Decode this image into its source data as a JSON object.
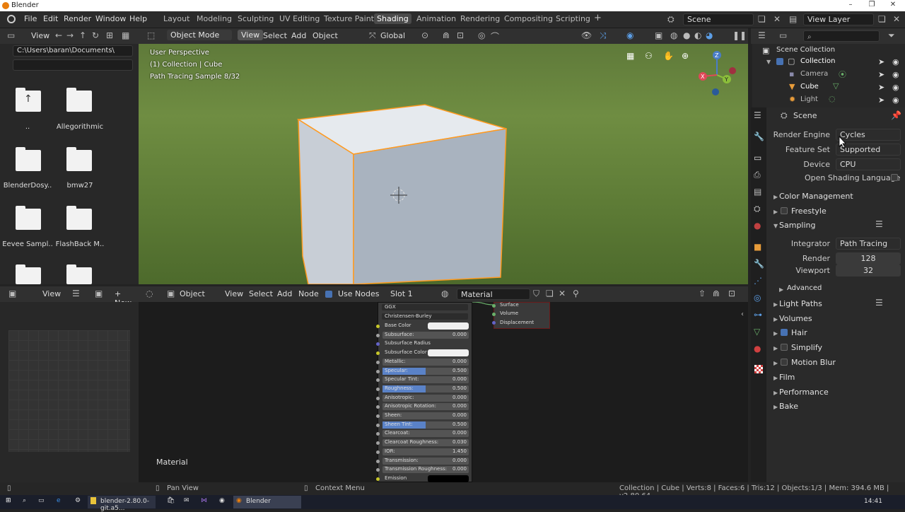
{
  "window": {
    "title": "Blender",
    "min": "–",
    "max": "❐",
    "close": "✕"
  },
  "menus": {
    "file": "File",
    "edit": "Edit",
    "render": "Render",
    "window": "Window",
    "help": "Help"
  },
  "workspaces": [
    "Layout",
    "Modeling",
    "Sculpting",
    "UV Editing",
    "Texture Paint",
    "Shading",
    "Animation",
    "Rendering",
    "Compositing",
    "Scripting"
  ],
  "workspace_add": "+",
  "scene": {
    "name": "Scene",
    "view_layer": "View Layer"
  },
  "filebrowser": {
    "view_label": "View",
    "path": "C:\\Users\\baran\\Documents\\",
    "filter": "",
    "items": [
      {
        "label": ".."
      },
      {
        "label": "Allegorithmic"
      },
      {
        "label": "BlenderDosy.."
      },
      {
        "label": "bmw27"
      },
      {
        "label": "Eevee Sampl.."
      },
      {
        "label": "FlashBack M.."
      },
      {
        "label": ""
      },
      {
        "label": ""
      }
    ]
  },
  "viewport": {
    "mode": "Object Mode",
    "view": "View",
    "select": "Select",
    "add": "Add",
    "object": "Object",
    "transform": "Global",
    "info1": "User Perspective",
    "info2": "(1) Collection | Cube",
    "info3": "Path Tracing Sample 8/32",
    "gizmo_x": "X",
    "gizmo_y": "Y",
    "gizmo_z": "Z"
  },
  "outliner": {
    "root": "Scene Collection",
    "items": [
      "Collection",
      "Camera",
      "Cube",
      "Light"
    ]
  },
  "properties": {
    "context": "Scene",
    "render_engine_label": "Render Engine",
    "render_engine": "Cycles",
    "feature_set_label": "Feature Set",
    "feature_set": "Supported",
    "device_label": "Device",
    "device": "CPU",
    "osl_label": "Open Shading Language",
    "color_management": "Color Management",
    "freestyle": "Freestyle",
    "sampling": "Sampling",
    "integrator_label": "Integrator",
    "integrator": "Path Tracing",
    "render_label": "Render",
    "render_samples": "128",
    "viewport_label": "Viewport",
    "viewport_samples": "32",
    "advanced": "Advanced",
    "light_paths": "Light Paths",
    "volumes": "Volumes",
    "hair": "Hair",
    "simplify": "Simplify",
    "motion_blur": "Motion Blur",
    "film": "Film",
    "performance": "Performance",
    "bake": "Bake"
  },
  "image_editor": {
    "view": "View",
    "new": "+ New"
  },
  "node_editor": {
    "object": "Object",
    "view": "View",
    "select": "Select",
    "add": "Add",
    "node": "Node",
    "use_nodes": "Use Nodes",
    "slot": "Slot 1",
    "material": "Material",
    "footer_material": "Material"
  },
  "bsdf": {
    "dist": "GGX",
    "sss": "Christensen-Burley",
    "rows": [
      {
        "label": "Base Color",
        "value": "",
        "kind": "color"
      },
      {
        "label": "Subsurface:",
        "value": "0.000",
        "kind": "val"
      },
      {
        "label": "Subsurface Radius",
        "value": "",
        "kind": "drop"
      },
      {
        "label": "Subsurface Color",
        "value": "",
        "kind": "color"
      },
      {
        "label": "Metallic:",
        "value": "0.000",
        "kind": "val"
      },
      {
        "label": "Specular:",
        "value": "0.500",
        "kind": "bar"
      },
      {
        "label": "Specular Tint:",
        "value": "0.000",
        "kind": "val"
      },
      {
        "label": "Roughness:",
        "value": "0.500",
        "kind": "bar"
      },
      {
        "label": "Anisotropic:",
        "value": "0.000",
        "kind": "val"
      },
      {
        "label": "Anisotropic Rotation:",
        "value": "0.000",
        "kind": "val"
      },
      {
        "label": "Sheen:",
        "value": "0.000",
        "kind": "val"
      },
      {
        "label": "Sheen Tint:",
        "value": "0.500",
        "kind": "bar"
      },
      {
        "label": "Clearcoat:",
        "value": "0.000",
        "kind": "val"
      },
      {
        "label": "Clearcoat Roughness:",
        "value": "0.030",
        "kind": "val"
      },
      {
        "label": "IOR:",
        "value": "1.450",
        "kind": "val"
      },
      {
        "label": "Transmission:",
        "value": "0.000",
        "kind": "val"
      },
      {
        "label": "Transmission Roughness:",
        "value": "0.000",
        "kind": "val"
      },
      {
        "label": "Emission",
        "value": "",
        "kind": "black"
      }
    ]
  },
  "output_node": {
    "surface": "Surface",
    "volume": "Volume",
    "displacement": "Displacement"
  },
  "status": {
    "pan": "Pan View",
    "context": "Context Menu",
    "stats": "Collection | Cube | Verts:8 | Faces:6 | Tris:12 | Objects:1/3 | Mem: 394.6 MB | v2.80.64"
  },
  "taskbar": {
    "app1": "blender-2.80.0-git.a5...",
    "app2": "Blender",
    "time": "14:41"
  }
}
